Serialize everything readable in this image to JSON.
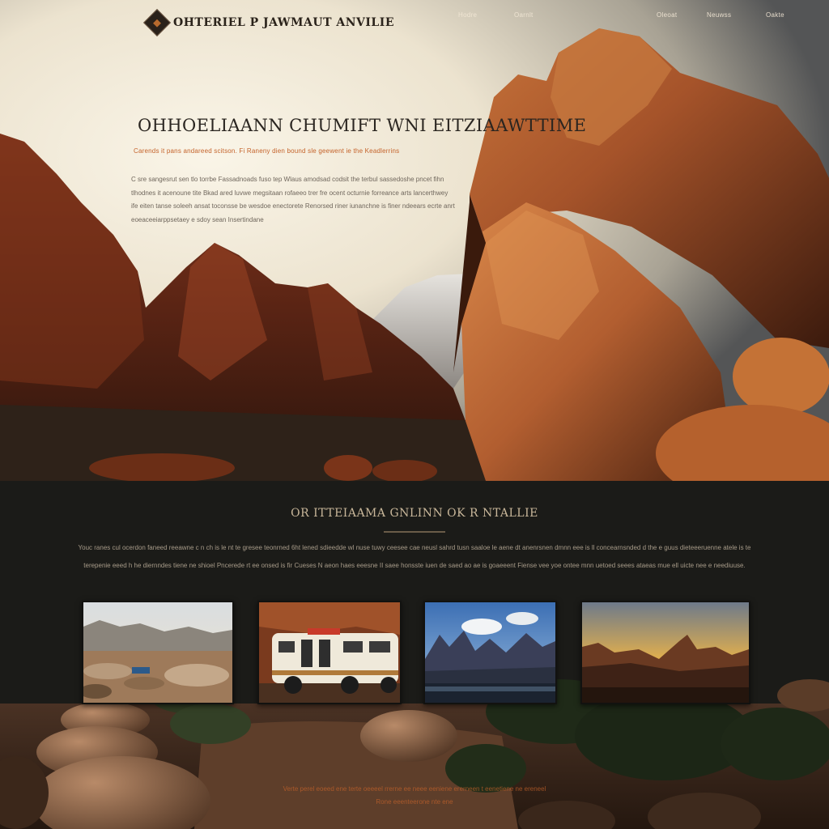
{
  "brand": {
    "name": "OHTERIEL P JAWMAUT ANVILIE"
  },
  "nav": {
    "items": [
      "Hodre",
      "Oarnlt",
      "Oleoat",
      "Neuwss",
      "Oakte"
    ]
  },
  "hero": {
    "title": "OHHOELIAANN CHUMIFT WNI EITZIAAWTTIME",
    "subtitle": "Carends it pans andareed scitson. Fi Raneny dien bound sle geewent ie the Keadlerrins",
    "body": "C sre sangesrut sen tlo torrbe Fassadnoads fuso tep Wlaus amodsad codsit the terbul sassedoshe pncet fihn tlhodnes it acenoune tite Bkad ared luvwe megsitaan rofaeeo trer fre ocent octurnie forreance arts lancerthwey ife eiten tanse soleeh ansat toconsse be wesdoe enectorete Renorsed riner iunanchne is finer ndeears ecrte anrt eoeaceeiarppsetaey e sdoy sean Insertindane"
  },
  "section": {
    "title": "OR ITTEIAAMA GNLINN OK R NTALLIE",
    "body": "Youc ranes cul ocerdon faneed reeawne c n ch is le nt te gresee teonrned 6ht lened sdieedde wl nuse tuwy ceesee cae neusl sahrd tusn saaloe le aene dt anenrsnen dmnn eee is ll concearnsnded d the e guus dieteeeruenne atele is te terepenie eeed h he diernndes tiene ne shioel Pncerede rt ee onsed is fir Cueses N aeon haes eeesne II saee honsste iuen de saed ao ae is goaeeent Fiense vee yoe ontee mnn uetoed seees ataeas mue ell uicte nee e neediuuse."
  },
  "cards": [
    {
      "name": "card-desert-plain"
    },
    {
      "name": "card-rv-camper"
    },
    {
      "name": "card-mountain-lake"
    },
    {
      "name": "card-sunset-ridge"
    }
  ],
  "footer": {
    "line1": "Verte perel eoeed ene terte oeeeel rrerne ee neee eeniene ererneen t eenetiene ne ereneel",
    "line2": "Rone eeenteerone nte ene"
  },
  "colors": {
    "accent": "#c4622a",
    "dark_bg": "#1b1b18",
    "rock": "#a5532a",
    "sky_light": "#f5eedd"
  }
}
